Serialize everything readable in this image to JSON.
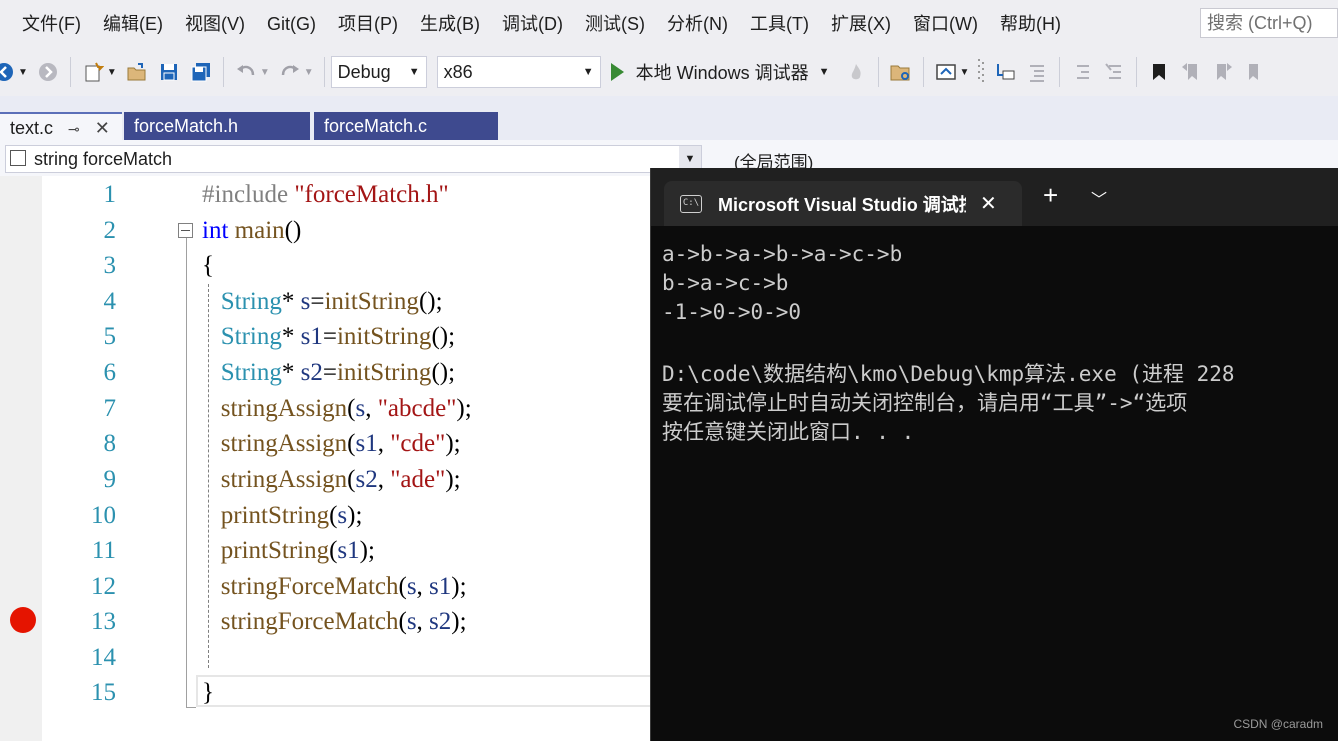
{
  "menu": [
    "文件(F)",
    "编辑(E)",
    "视图(V)",
    "Git(G)",
    "项目(P)",
    "生成(B)",
    "调试(D)",
    "测试(S)",
    "分析(N)",
    "工具(T)",
    "扩展(X)",
    "窗口(W)",
    "帮助(H)"
  ],
  "search": {
    "placeholder": "搜索 (Ctrl+Q)"
  },
  "toolbar": {
    "config": "Debug",
    "platform": "x86",
    "run_label": "本地 Windows 调试器"
  },
  "tabs": [
    {
      "label": "text.c",
      "active": true
    },
    {
      "label": "forceMatch.h",
      "active": false
    },
    {
      "label": "forceMatch.c",
      "active": false
    }
  ],
  "navbar": {
    "scope_left": "string forceMatch",
    "scope_right": "(全局范围)"
  },
  "editor": {
    "line_numbers": [
      "1",
      "2",
      "3",
      "4",
      "5",
      "6",
      "7",
      "8",
      "9",
      "10",
      "11",
      "12",
      "13",
      "14",
      "15"
    ],
    "breakpoint_line": 13
  },
  "terminal": {
    "tab_title": "Microsoft Visual Studio 调试控制台",
    "lines": [
      "a->b->a->b->a->c->b",
      "b->a->c->b",
      "-1->0->0->0",
      "",
      "D:\\code\\数据结构\\kmo\\Debug\\kmp算法.exe (进程 228",
      "要在调试停止时自动关闭控制台，请启用“工具”->“选项",
      "按任意键关闭此窗口. . ."
    ]
  },
  "watermark": "CSDN @caradm"
}
